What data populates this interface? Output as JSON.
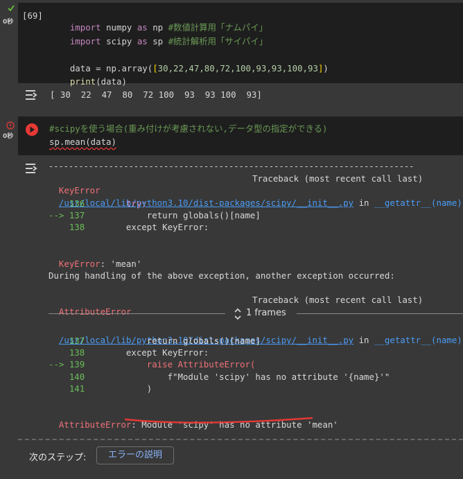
{
  "cell1": {
    "status_icon": "check-icon",
    "exec_time": "0秒",
    "exec_count": "[69]",
    "code": {
      "l1": {
        "kw1": "import",
        "mod": " numpy ",
        "kw2": "as",
        "alias": " np ",
        "comment": "#数値計算用「ナムパイ」"
      },
      "l2": {
        "kw1": "import",
        "mod": " scipy ",
        "kw2": "as",
        "alias": " sp ",
        "comment": "#統計解析用「サイパイ」"
      },
      "l3": {
        "prefix": "data = np.array(",
        "open": "[",
        "nums": "30,22,47,80,72,100,93,93,100,93",
        "close": "]",
        "end": ")"
      },
      "l4": {
        "fn": "print",
        "args": "(data)"
      }
    },
    "output": "[ 30  22  47  80  72 100  93  93 100  93]"
  },
  "cell2": {
    "status_icon": "error-icon",
    "exec_time": "0秒",
    "run_icon": "run-icon",
    "code": {
      "comment": "#scipyを使う場合(重み付けが考慮されない,データ型の指定ができる)",
      "call": "sp.mean(data)"
    }
  },
  "traceback": {
    "dashes": "---------------------------------------------------------------------------",
    "err1_name": "KeyError",
    "err1_trace": "Traceback (most recent call last)",
    "file1_path": "/usr/local/lib/python3.10/dist-packages/scipy/__init__.py",
    "file1_in": " in ",
    "file1_func": "__getattr__(name)",
    "b1": {
      "l1n": "    136",
      "l1c": "        try:",
      "l2n": "--> 137",
      "l2c": "            return globals()[name]",
      "l3n": "    138",
      "l3c": "        except KeyError:"
    },
    "keyerror_label": "KeyError",
    "keyerror_msg": ": 'mean'",
    "during": "During handling of the above exception, another exception occurred:",
    "err2_name": "AttributeError",
    "err2_trace": "Traceback (most recent call last)",
    "frames": "1 frames",
    "file2_path": "/usr/local/lib/python3.10/dist-packages/scipy/__init__.py",
    "file2_in": " in ",
    "file2_func": "__getattr__(name)",
    "b2": {
      "l1n": "    137",
      "l1c": "            return globals()[name]",
      "l2n": "    138",
      "l2c": "        except KeyError:",
      "l3n": "--> 139",
      "l3c": "            raise AttributeError(",
      "l4n": "    140",
      "l4c": "                f\"Module 'scipy' has no attribute '{name}'\"",
      "l5n": "    141",
      "l5c": "            )"
    },
    "final_label": "AttributeError",
    "final_msg": "Module 'scipy' has no attribute 'mean'"
  },
  "next_step": {
    "label": "次のステップ:",
    "button": "エラーの説明"
  },
  "colors": {
    "accent": "#e53935",
    "link": "#4b9cf5",
    "error_text": "#f07178"
  }
}
